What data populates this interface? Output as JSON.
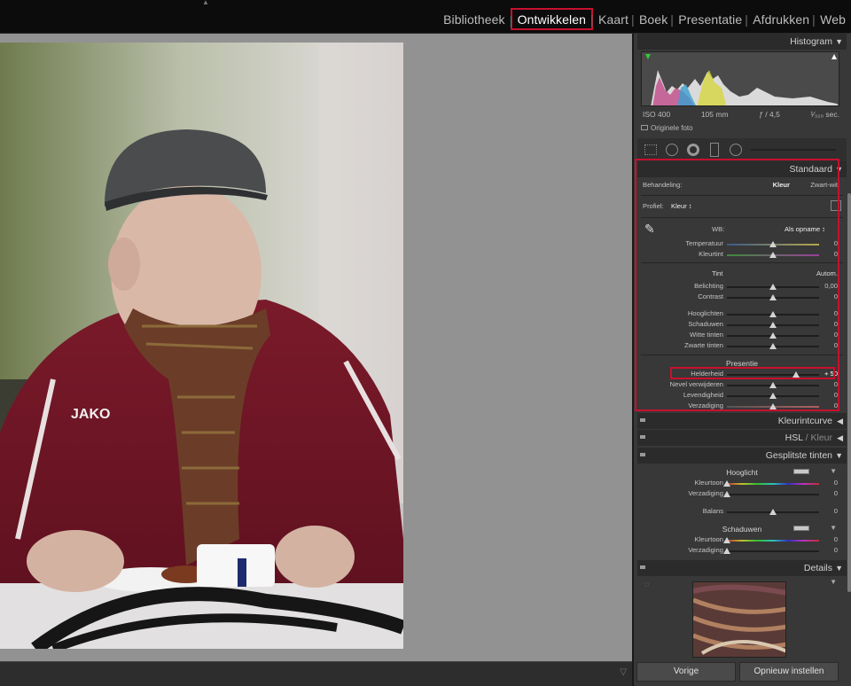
{
  "modules": [
    "Bibliotheek",
    "Ontwikkelen",
    "Kaart",
    "Boek",
    "Presentatie",
    "Afdrukken",
    "Web"
  ],
  "active_module": "Ontwikkelen",
  "histogram": {
    "title": "Histogram",
    "iso": "ISO 400",
    "focal": "105 mm",
    "aperture": "ƒ / 4,5",
    "shutter": "¹⁄₃₂₀ sec.",
    "original": "Originele foto"
  },
  "basic": {
    "title": "Standaard",
    "treatment_label": "Behandeling:",
    "treatment_color": "Kleur",
    "treatment_bw": "Zwart-wit",
    "profile_label": "Profiel:",
    "profile_value": "Kleur ↕",
    "wb_label": "WB:",
    "wb_value": "Als opname ↕",
    "temp_label": "Temperatuur",
    "temp_value": "0",
    "tint_label": "Kleurtint",
    "tint_value": "0",
    "tone_head": "Tint",
    "tone_auto": "Autom.",
    "exposure_label": "Belichting",
    "exposure_value": "0,00",
    "contrast_label": "Contrast",
    "contrast_value": "0",
    "highlights_label": "Hooglichten",
    "highlights_value": "0",
    "shadows_label": "Schaduwen",
    "shadows_value": "0",
    "whites_label": "Witte tinten",
    "whites_value": "0",
    "blacks_label": "Zwarte tinten",
    "blacks_value": "0",
    "presence_head": "Presentie",
    "clarity_label": "Helderheid",
    "clarity_value": "+ 50",
    "dehaze_label": "Nevel verwijderen",
    "dehaze_value": "0",
    "vibrance_label": "Levendigheid",
    "vibrance_value": "0",
    "saturation_label": "Verzadiging",
    "saturation_value": "0"
  },
  "tone_curve_title": "Kleurintcurve",
  "hsl_title": "HSL",
  "hsl_color": "Kleur",
  "split": {
    "title": "Gesplitste tinten",
    "highlight_head": "Hooglicht",
    "hue_label": "Kleurtoon",
    "hue_value": "0",
    "sat_label": "Verzadiging",
    "sat_value": "0",
    "balance_label": "Balans",
    "balance_value": "0",
    "shadow_head": "Schaduwen",
    "s_hue_label": "Kleurtoon",
    "s_hue_value": "0",
    "s_sat_label": "Verzadiging",
    "s_sat_value": "0"
  },
  "details_title": "Details",
  "buttons": {
    "previous": "Vorige",
    "reset": "Opnieuw instellen"
  },
  "photo_text": "JAKO",
  "colors": {
    "accent_red": "#c8102e",
    "panel_bg": "#383838",
    "canvas_bg": "#929292"
  }
}
